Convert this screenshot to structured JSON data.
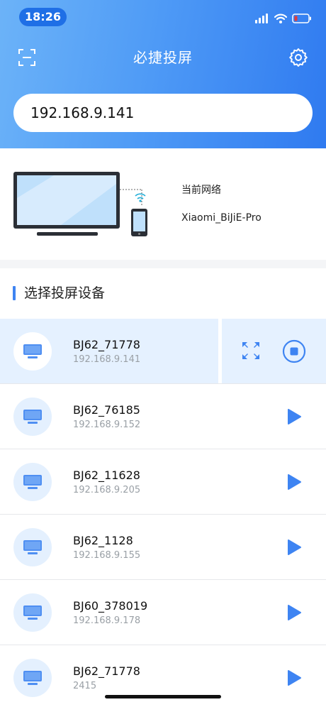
{
  "status_bar": {
    "time": "18:26"
  },
  "header": {
    "title": "必捷投屏",
    "ip_value": "192.168.9.141"
  },
  "network": {
    "label": "当前网络",
    "name": "Xiaomi_BiJiE-Pro"
  },
  "devices_section": {
    "title": "选择投屏设备",
    "devices": [
      {
        "name": "BJ62_71778",
        "ip": "192.168.9.141",
        "state": "casting"
      },
      {
        "name": "BJ62_76185",
        "ip": "192.168.9.152",
        "state": "idle"
      },
      {
        "name": "BJ62_11628",
        "ip": "192.168.9.205",
        "state": "idle"
      },
      {
        "name": "BJ62_1128",
        "ip": "192.168.9.155",
        "state": "idle"
      },
      {
        "name": "BJ60_378019",
        "ip": "192.168.9.178",
        "state": "idle"
      },
      {
        "name": "BJ62_71778",
        "ip": "2415",
        "state": "idle"
      }
    ]
  },
  "icons": {
    "scan": "scan-icon",
    "settings": "gear-icon",
    "device": "monitor-icon",
    "play": "play-icon",
    "fullscreen": "fullscreen-icon",
    "stop": "stop-icon"
  },
  "colors": {
    "accent": "#3e84f2",
    "active_row": "#e5f1ff",
    "header_start": "#6cb3f8",
    "header_end": "#2f7af0"
  }
}
